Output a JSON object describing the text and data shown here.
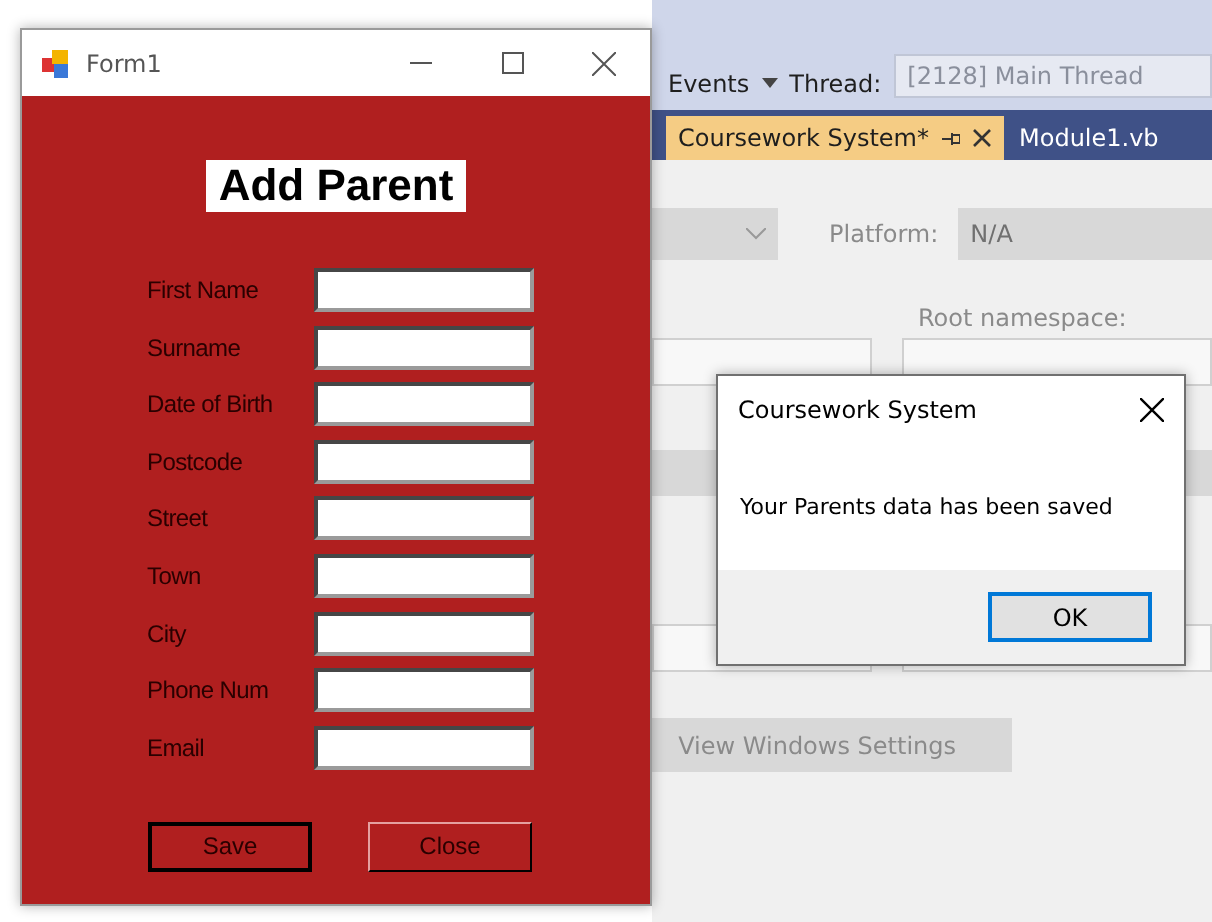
{
  "ide": {
    "toolbar": {
      "events_label": "Events",
      "thread_label": "Thread:",
      "thread_value": "[2128] Main Thread"
    },
    "tabs": [
      {
        "label": "Coursework System*",
        "selected": true
      },
      {
        "label": "Module1.vb",
        "selected": false
      }
    ],
    "properties": {
      "platform_label": "Platform:",
      "platform_value": "N/A",
      "root_namespace_label": "Root namespace:",
      "view_windows_settings": "View Windows Settings"
    }
  },
  "form": {
    "title": "Form1",
    "heading": "Add Parent",
    "fields": [
      {
        "label": "First Name"
      },
      {
        "label": "Surname"
      },
      {
        "label": "Date of Birth"
      },
      {
        "label": "Postcode"
      },
      {
        "label": "Street"
      },
      {
        "label": "Town"
      },
      {
        "label": "City"
      },
      {
        "label": "Phone Num"
      },
      {
        "label": "Email"
      }
    ],
    "buttons": [
      {
        "label": "Save",
        "selected": true
      },
      {
        "label": "Close",
        "selected": false
      }
    ]
  },
  "dialog": {
    "title": "Coursework System",
    "message": "Your Parents data has been saved",
    "button": "OK"
  }
}
